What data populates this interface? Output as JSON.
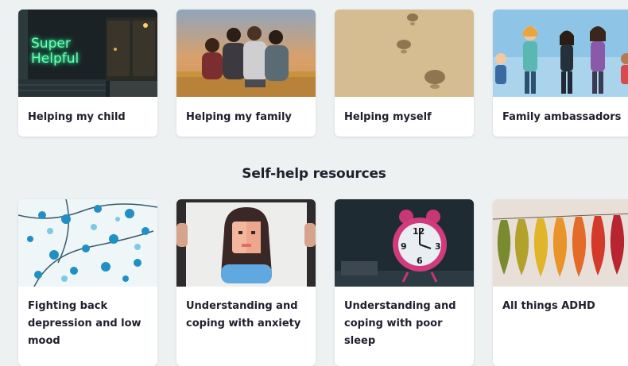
{
  "top_cards": [
    {
      "label": "Helping my child",
      "neon_text": "Super Helpful"
    },
    {
      "label": "Helping my family"
    },
    {
      "label": "Helping myself"
    },
    {
      "label": "Family ambassadors"
    }
  ],
  "section_heading": "Self-help resources",
  "resource_cards": [
    {
      "label": "Fighting back depression and low mood"
    },
    {
      "label": "Understanding and coping with anxiety"
    },
    {
      "label": "Understanding and coping with poor sleep",
      "clock_numbers": [
        "12",
        "3",
        "6",
        "9"
      ]
    },
    {
      "label": "All things ADHD"
    }
  ]
}
